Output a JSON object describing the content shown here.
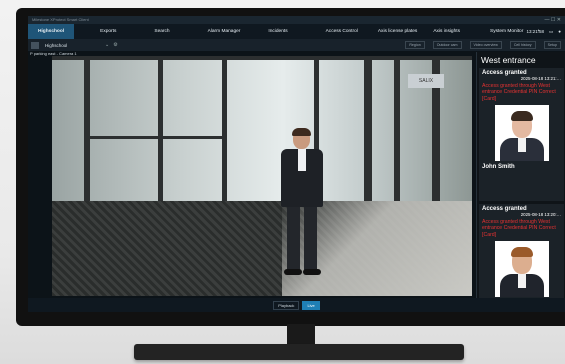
{
  "window": {
    "title": "Milestone XProtect Smart Client",
    "controls": "— ☐ ✕"
  },
  "nav": {
    "tabs": [
      {
        "label": "Highschool",
        "active": true
      },
      {
        "label": "Exports"
      },
      {
        "label": "Search"
      },
      {
        "label": "Alarm Manager"
      },
      {
        "label": "Incidents"
      },
      {
        "label": "Access Control"
      },
      {
        "label": "Axis license plates"
      },
      {
        "label": "Axis insights"
      },
      {
        "label": "System Monitor"
      },
      {
        "label": "+"
      }
    ],
    "time": "13:21:58"
  },
  "toolbar": {
    "site": "Highschool",
    "pills": [
      "Region",
      "Outdoor cam",
      "Video overview",
      "Cell history",
      "Setup"
    ]
  },
  "camera": {
    "label": "P parking east - Camera 1",
    "sign_text": "SALIX"
  },
  "playback": {
    "buttons": [
      "Playback",
      "Live"
    ]
  },
  "panel": {
    "title": "West entrance",
    "events": [
      {
        "title": "Access granted",
        "time": "2025-08-18 13:21:…",
        "message": "Access granted through West entrance Credential PIN Correct [Card]",
        "name": "John Smith",
        "skin": "#e4b9a1",
        "hair": "#3a2a20",
        "suit": "#2a2f3a"
      },
      {
        "title": "Access granted",
        "time": "2025-08-18 13:20:…",
        "message": "Access granted through West entrance Credential PIN Correct [Card]",
        "name": "",
        "skin": "#dcae8f",
        "hair": "#9a5a2a",
        "suit": "#20242c"
      }
    ]
  }
}
